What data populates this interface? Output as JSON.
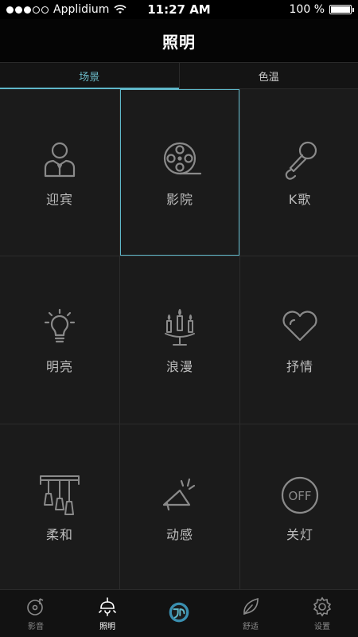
{
  "status_bar": {
    "carrier": "Applidium",
    "time": "11:27 AM",
    "battery": "100 %"
  },
  "header": {
    "title": "照明"
  },
  "tabs": [
    {
      "label": "场景",
      "active": true
    },
    {
      "label": "色温",
      "active": false
    }
  ],
  "scenes": [
    {
      "label": "迎宾",
      "icon": "host-person-icon"
    },
    {
      "label": "影院",
      "icon": "film-reel-icon",
      "selected": true
    },
    {
      "label": "K歌",
      "icon": "microphone-icon"
    },
    {
      "label": "明亮",
      "icon": "light-bulb-icon"
    },
    {
      "label": "浪漫",
      "icon": "candles-icon"
    },
    {
      "label": "抒情",
      "icon": "heart-icon"
    },
    {
      "label": "柔和",
      "icon": "pendant-lamps-icon"
    },
    {
      "label": "动感",
      "icon": "megaphone-icon"
    },
    {
      "label": "关灯",
      "icon": "off-button-icon",
      "icon_text": "OFF"
    }
  ],
  "tabbar": [
    {
      "label": "影音",
      "icon": "music-disc-icon"
    },
    {
      "label": "照明",
      "icon": "ceiling-lamp-icon",
      "active": true
    },
    {
      "label": "",
      "icon": "app-logo-icon"
    },
    {
      "label": "舒适",
      "icon": "leaf-icon"
    },
    {
      "label": "设置",
      "icon": "gear-icon"
    }
  ],
  "colors": {
    "accent": "#5fb7c9",
    "background": "#1b1b1b",
    "icon_stroke": "#8a8a8a"
  }
}
